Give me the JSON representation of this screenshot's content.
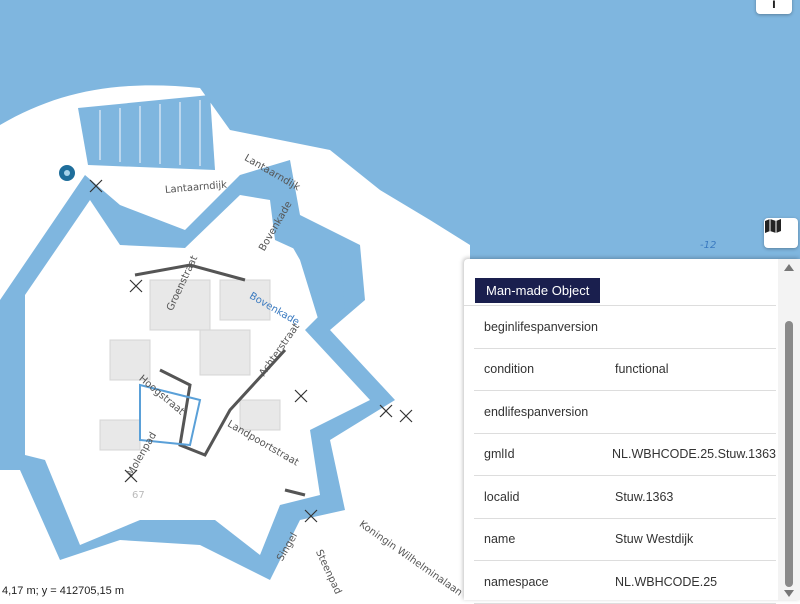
{
  "map": {
    "labels": {
      "lantaarndijk_1": "Lantaarndijk",
      "lantaarndijk_2": "Lantaarndijk",
      "bovenkade_1": "Bovenkade",
      "bovenkade_2": "Bovenkade",
      "groenstraat": "Groenstraat",
      "hoogstraat": "Hoogstraat",
      "molenpad": "Molenpad",
      "landpoortstraat": "Landpoortstraat",
      "achterstraat": "Achterstraat",
      "koningin": "Koningin Wilhelminalaan",
      "singel": "Singel",
      "steenpad": "Steenpad",
      "number_67": "67",
      "depth": "-12"
    },
    "coordinates": "4,17 m; y = 412705,15 m",
    "colors": {
      "water": "#7fb6df",
      "land": "#ffffff",
      "canal_edge": "#6aa7d6",
      "accent": "#1a1f4e"
    }
  },
  "controls": {
    "info_icon": "info-icon",
    "info_glyph": "i",
    "layers_icon": "map-layers-icon"
  },
  "panel": {
    "title": "Man-made Object",
    "rows": [
      {
        "key": "beginlifespanversion",
        "value": ""
      },
      {
        "key": "condition",
        "value": "functional"
      },
      {
        "key": "endlifespanversion",
        "value": ""
      },
      {
        "key": "gmlId",
        "value": "NL.WBHCODE.25.Stuw.1363"
      },
      {
        "key": "localid",
        "value": "Stuw.1363"
      },
      {
        "key": "name",
        "value": "Stuw Westdijk"
      },
      {
        "key": "namespace",
        "value": "NL.WBHCODE.25"
      }
    ]
  }
}
